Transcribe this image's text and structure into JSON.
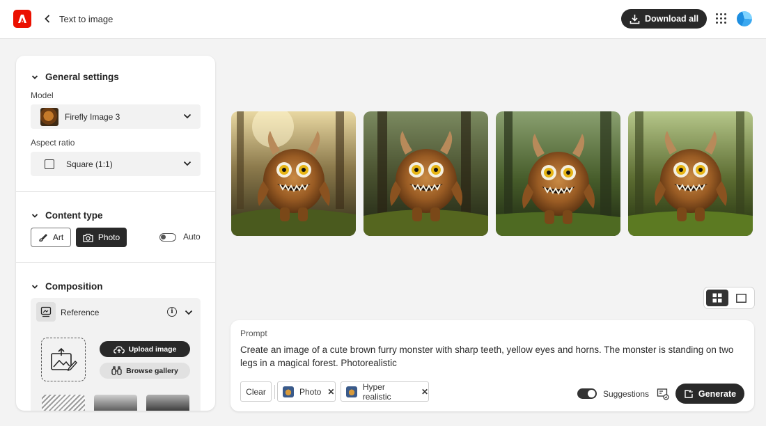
{
  "header": {
    "title": "Text to image",
    "download_all": "Download all"
  },
  "general_settings": {
    "heading": "General settings",
    "model_label": "Model",
    "model_value": "Firefly Image 3",
    "aspect_label": "Aspect ratio",
    "aspect_value": "Square (1:1)"
  },
  "content_type": {
    "heading": "Content type",
    "art_label": "Art",
    "photo_label": "Photo",
    "auto_label": "Auto",
    "selected": "Photo"
  },
  "composition": {
    "heading": "Composition",
    "reference_label": "Reference",
    "upload_image": "Upload image",
    "browse_gallery": "Browse gallery"
  },
  "gallery": {
    "images": [
      "monster-image-1",
      "monster-image-2",
      "monster-image-3",
      "monster-image-4"
    ],
    "view_mode": "grid"
  },
  "prompt": {
    "label": "Prompt",
    "text": "Create an image of a cute brown furry monster with sharp teeth, yellow eyes and horns. The monster is standing on two legs in a magical forest. Photorealistic",
    "clear": "Clear",
    "chips": [
      "Photo",
      "Hyper realistic"
    ],
    "suggestions_label": "Suggestions",
    "suggestions_on": true,
    "generate": "Generate"
  },
  "colors": {
    "brand": "#eb1000",
    "dark_button": "#292929"
  }
}
